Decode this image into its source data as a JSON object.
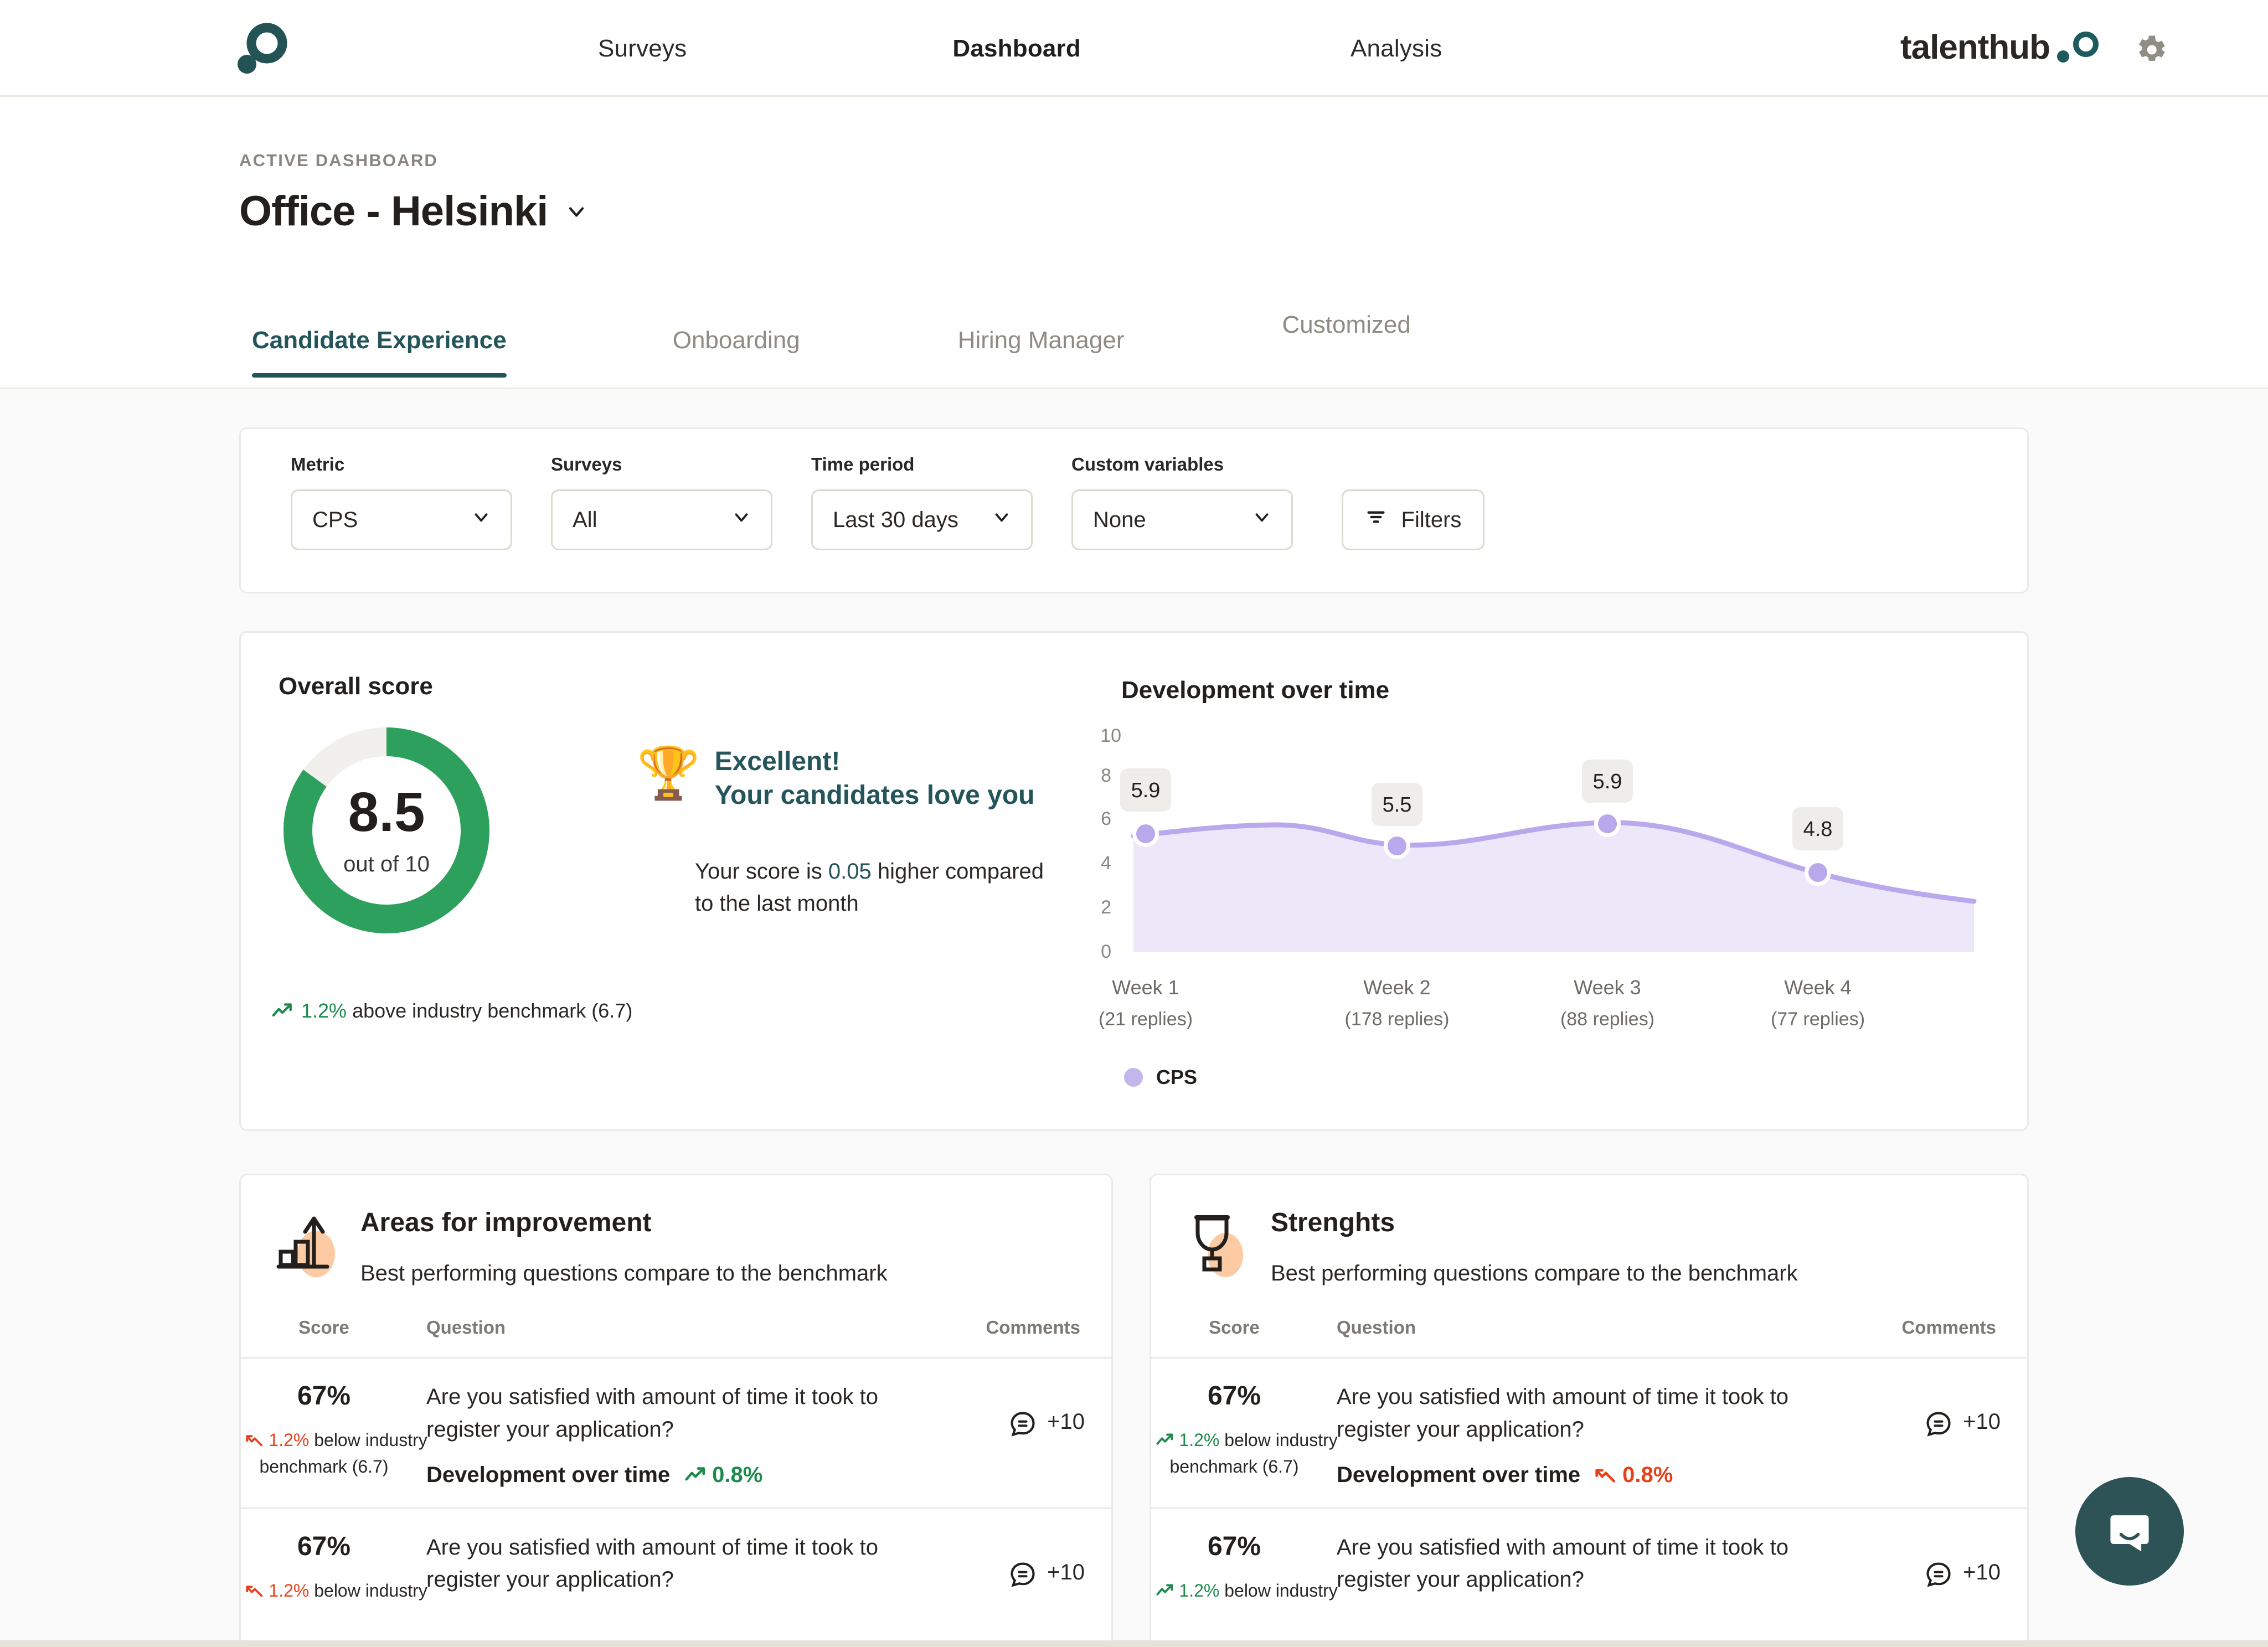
{
  "header": {
    "logo_icon": "talenthub-dot-ring-logo",
    "nav": [
      {
        "label": "Surveys",
        "active": false
      },
      {
        "label": "Dashboard",
        "active": true
      },
      {
        "label": "Analysis",
        "active": false
      }
    ],
    "wordmark": "talenthub",
    "settings_icon": "gear-icon"
  },
  "page": {
    "eyebrow": "ACTIVE DASHBOARD",
    "title": "Office - Helsinki",
    "title_chevron_icon": "chevron-down-icon"
  },
  "tabs": [
    {
      "label": "Candidate Experience",
      "active": true
    },
    {
      "label": "Onboarding",
      "active": false
    },
    {
      "label": "Hiring Manager",
      "active": false
    },
    {
      "label": "Customized",
      "active": false
    }
  ],
  "filters": {
    "metric": {
      "label": "Metric",
      "value": "CPS"
    },
    "surveys": {
      "label": "Surveys",
      "value": "All"
    },
    "time_period": {
      "label": "Time period",
      "value": "Last 30 days"
    },
    "custom_variables": {
      "label": "Custom variables",
      "value": "None"
    },
    "filters_button": {
      "label": "Filters",
      "icon": "filter-lines-icon"
    }
  },
  "overall_score": {
    "title": "Overall score",
    "score": "8.5",
    "out_of": "out of 10",
    "percent": 85,
    "ring_color": "#2ea05e",
    "track_color": "#f1f0ec",
    "benchmark": {
      "trend_icon": "trend-up-icon",
      "percent": "1.2%",
      "text": "above industry benchmark (6.7)"
    },
    "praise": {
      "emoji": "trophy-confetti",
      "line1": "Excellent!",
      "line2": "Your candidates love you",
      "sub_prefix": "Your score is ",
      "sub_value": "0.05",
      "sub_suffix": " higher compared to the last month"
    }
  },
  "chart_data": {
    "type": "area",
    "title": "Development over time",
    "categories": [
      "Week 1",
      "Week 2",
      "Week 3",
      "Week 4"
    ],
    "sublabels": [
      "(21 replies)",
      "(178 replies)",
      "(88 replies)",
      "(77 replies)"
    ],
    "series": [
      {
        "name": "CPS",
        "values": [
          5.9,
          5.5,
          5.9,
          4.8
        ],
        "color": "#b9a9ec",
        "fill": "#ece8f9"
      }
    ],
    "point_labels": [
      "5.9",
      "5.5",
      "5.9",
      "4.8"
    ],
    "yticks": [
      "10",
      "8",
      "6",
      "4",
      "2",
      "0"
    ],
    "ylim": [
      0,
      10
    ],
    "xlabel": "",
    "ylabel": "",
    "grid": false,
    "legend": [
      {
        "label": "CPS",
        "color": "#c3b6ed"
      }
    ],
    "legend_position": "bottom-left"
  },
  "areas_for_improvement": {
    "icon": "bar-chart-up-icon",
    "title": "Areas for improvement",
    "subtitle": "Best performing questions compare to the benchmark",
    "columns": {
      "score": "Score",
      "question": "Question",
      "comments": "Comments"
    },
    "rows": [
      {
        "score": "67%",
        "trend_icon": "trend-down-icon",
        "trend_direction": "down",
        "trend_percent": "1.2%",
        "trend_text_line1": "below industry",
        "trend_text_line2": "benchmark (6.7)",
        "question": "Are you satisfied with amount of time it took to register your application?",
        "dev_label": "Development over time",
        "dev_icon": "trend-up-icon",
        "dev_direction": "up",
        "dev_percent": "0.8%",
        "comments_icon": "comment-icon",
        "comments": "+10"
      },
      {
        "score": "67%",
        "trend_icon": "trend-down-icon",
        "trend_direction": "down",
        "trend_percent": "1.2%",
        "trend_text_line1": "below industry",
        "trend_text_line2": "",
        "question": "Are you satisfied with amount of time it took to register your application?",
        "dev_label": "",
        "dev_icon": "",
        "dev_direction": "",
        "dev_percent": "",
        "comments_icon": "comment-icon",
        "comments": "+10"
      }
    ]
  },
  "strengths": {
    "icon": "trophy-icon",
    "title": "Strenghts",
    "subtitle": "Best performing questions compare to the benchmark",
    "columns": {
      "score": "Score",
      "question": "Question",
      "comments": "Comments"
    },
    "rows": [
      {
        "score": "67%",
        "trend_icon": "trend-up-icon",
        "trend_direction": "up",
        "trend_percent": "1.2%",
        "trend_text_line1": "below industry",
        "trend_text_line2": "benchmark (6.7)",
        "question": "Are you satisfied with amount of time it took to register your application?",
        "dev_label": "Development over time",
        "dev_icon": "trend-down-icon",
        "dev_direction": "down",
        "dev_percent": "0.8%",
        "comments_icon": "comment-icon",
        "comments": "+10"
      },
      {
        "score": "67%",
        "trend_icon": "trend-up-icon",
        "trend_direction": "up",
        "trend_percent": "1.2%",
        "trend_text_line1": "below industry",
        "trend_text_line2": "",
        "question": "Are you satisfied with amount of time it took to register your application?",
        "dev_label": "",
        "dev_icon": "",
        "dev_direction": "",
        "dev_percent": "",
        "comments_icon": "comment-icon",
        "comments": "+10"
      }
    ]
  },
  "chat": {
    "icon": "chat-bubble-smile-icon"
  },
  "colors": {
    "brand_teal": "#2e5356",
    "accent_green": "#2ea05e",
    "accent_red": "#e8401a",
    "chart_purple": "#b9a9ec",
    "page_bg": "#fafafa"
  }
}
